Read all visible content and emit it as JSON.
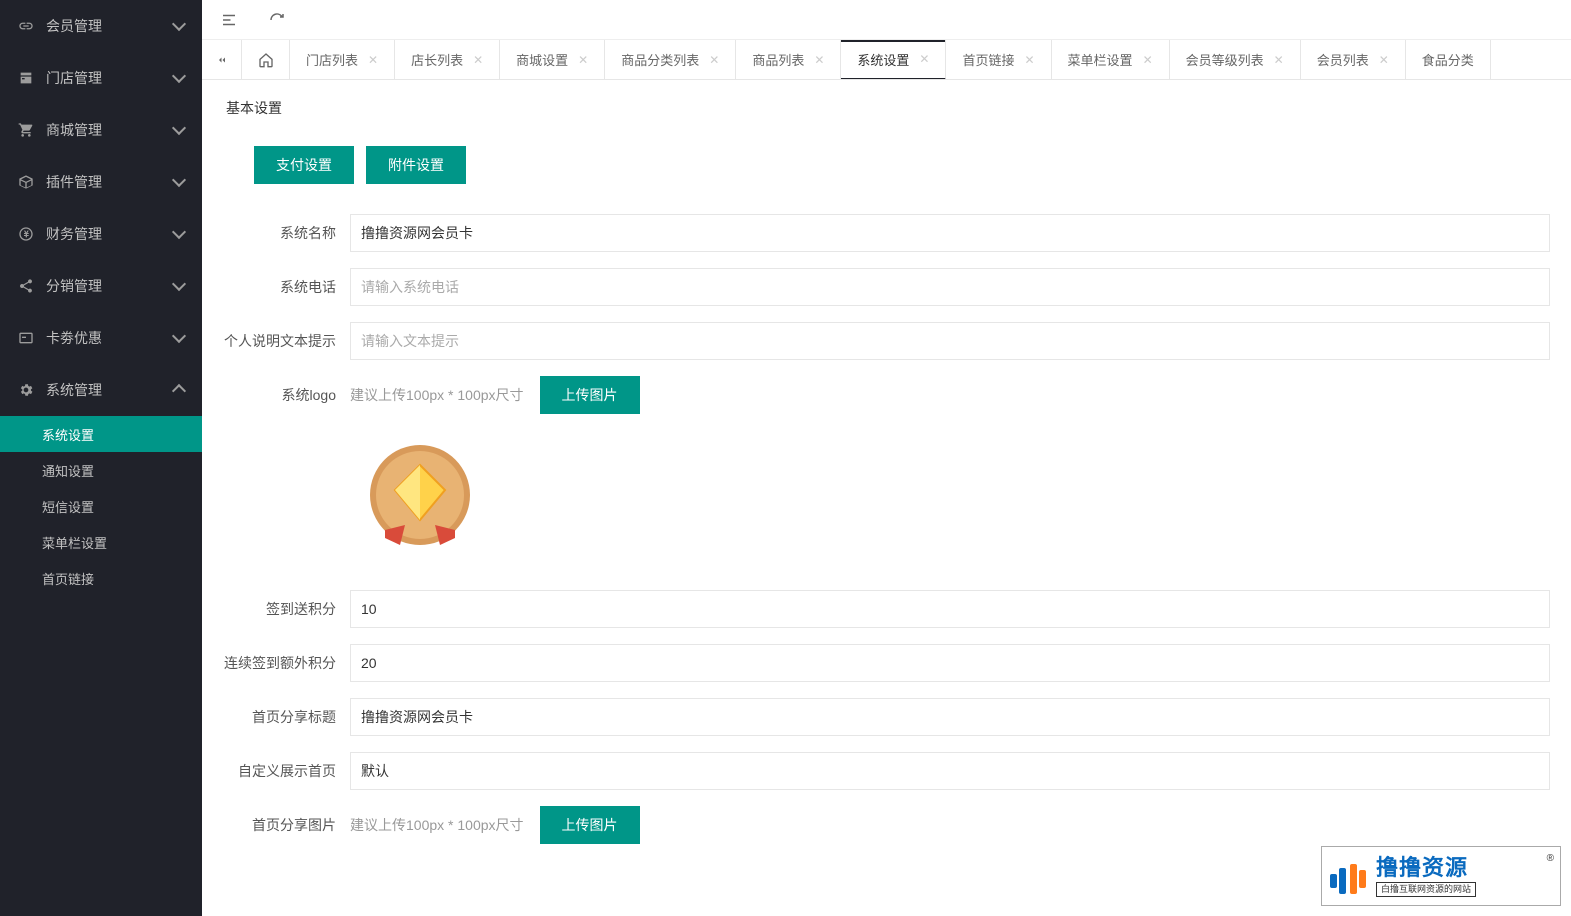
{
  "sidebar": {
    "items": [
      {
        "label": "会员管理",
        "icon": "link"
      },
      {
        "label": "门店管理",
        "icon": "store"
      },
      {
        "label": "商城管理",
        "icon": "cart"
      },
      {
        "label": "插件管理",
        "icon": "cube"
      },
      {
        "label": "财务管理",
        "icon": "yuan"
      },
      {
        "label": "分销管理",
        "icon": "share"
      },
      {
        "label": "卡劵优惠",
        "icon": "card"
      },
      {
        "label": "系统管理",
        "icon": "gear",
        "expanded": true,
        "sub": [
          {
            "label": "系统设置",
            "active": true
          },
          {
            "label": "通知设置"
          },
          {
            "label": "短信设置"
          },
          {
            "label": "菜单栏设置"
          },
          {
            "label": "首页链接"
          }
        ]
      }
    ]
  },
  "tabs": [
    {
      "label": "门店列表"
    },
    {
      "label": "店长列表"
    },
    {
      "label": "商城设置"
    },
    {
      "label": "商品分类列表"
    },
    {
      "label": "商品列表"
    },
    {
      "label": "系统设置",
      "active": true
    },
    {
      "label": "首页链接"
    },
    {
      "label": "菜单栏设置"
    },
    {
      "label": "会员等级列表"
    },
    {
      "label": "会员列表"
    },
    {
      "label": "食品分类"
    }
  ],
  "panel": {
    "title": "基本设置",
    "buttons": {
      "pay": "支付设置",
      "attach": "附件设置"
    },
    "fields": {
      "system_name": {
        "label": "系统名称",
        "value": "撸撸资源网会员卡"
      },
      "system_phone": {
        "label": "系统电话",
        "placeholder": "请输入系统电话"
      },
      "personal_hint": {
        "label": "个人说明文本提示",
        "placeholder": "请输入文本提示"
      },
      "system_logo": {
        "label": "系统logo",
        "hint": "建议上传100px * 100px尺寸",
        "btn": "上传图片"
      },
      "signin_points": {
        "label": "签到送积分",
        "value": "10"
      },
      "continuous_points": {
        "label": "连续签到额外积分",
        "value": "20"
      },
      "share_title": {
        "label": "首页分享标题",
        "value": "撸撸资源网会员卡"
      },
      "custom_home": {
        "label": "自定义展示首页",
        "value": "默认"
      },
      "share_image": {
        "label": "首页分享图片",
        "hint": "建议上传100px * 100px尺寸",
        "btn": "上传图片"
      }
    }
  },
  "watermark": {
    "main": "撸撸资源",
    "sub": "白撸互联网资源的网站",
    "r": "®"
  }
}
